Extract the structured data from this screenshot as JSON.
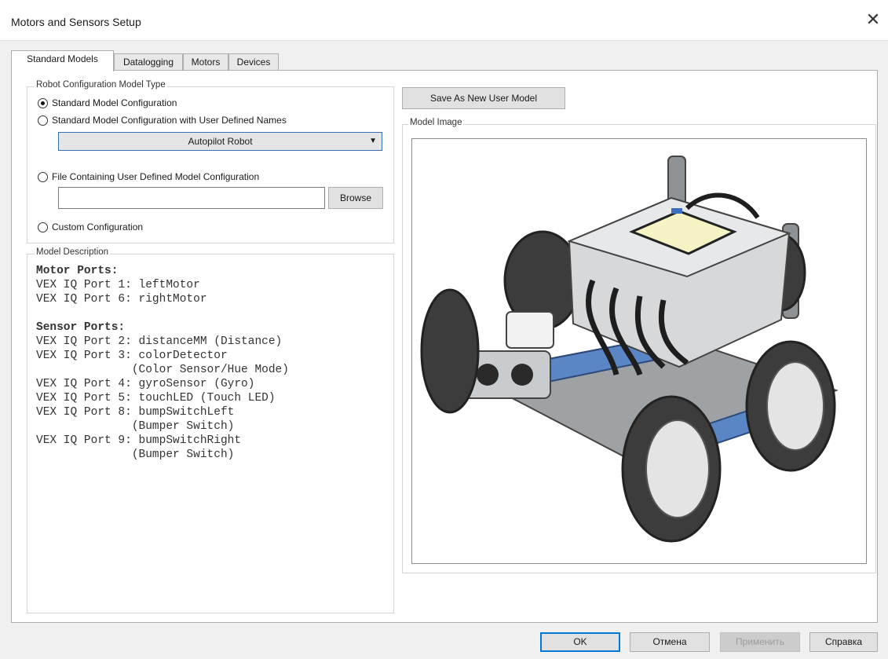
{
  "window": {
    "title": "Motors and Sensors Setup",
    "close_glyph": "✕"
  },
  "tabs": [
    {
      "label": "Standard Models",
      "active": true
    },
    {
      "label": "Datalogging",
      "active": false
    },
    {
      "label": "Motors",
      "active": false
    },
    {
      "label": "Devices",
      "active": false
    }
  ],
  "config_group": {
    "legend": "Robot Configuration Model Type",
    "options": [
      {
        "label": "Standard Model Configuration",
        "selected": true
      },
      {
        "label": "Standard Model Configuration with User Defined Names",
        "selected": false
      },
      {
        "label": "File Containing User Defined Model Configuration",
        "selected": false
      },
      {
        "label": "Custom Configuration",
        "selected": false
      }
    ],
    "model_select": {
      "value": "Autopilot Robot"
    },
    "file_input": {
      "value": ""
    },
    "browse_label": "Browse"
  },
  "description_group": {
    "legend": "Model Description",
    "lines": [
      {
        "text": "Motor Ports:",
        "bold": true
      },
      {
        "text": "VEX IQ Port 1: leftMotor",
        "bold": false
      },
      {
        "text": "VEX IQ Port 6: rightMotor",
        "bold": false
      },
      {
        "text": "",
        "bold": false
      },
      {
        "text": "Sensor Ports:",
        "bold": true
      },
      {
        "text": "VEX IQ Port 2: distanceMM (Distance)",
        "bold": false
      },
      {
        "text": "VEX IQ Port 3: colorDetector",
        "bold": false
      },
      {
        "text": "              (Color Sensor/Hue Mode)",
        "bold": false
      },
      {
        "text": "VEX IQ Port 4: gyroSensor (Gyro)",
        "bold": false
      },
      {
        "text": "VEX IQ Port 5: touchLED (Touch LED)",
        "bold": false
      },
      {
        "text": "VEX IQ Port 8: bumpSwitchLeft",
        "bold": false
      },
      {
        "text": "              (Bumper Switch)",
        "bold": false
      },
      {
        "text": "VEX IQ Port 9: bumpSwitchRight",
        "bold": false
      },
      {
        "text": "              (Bumper Switch)",
        "bold": false
      }
    ]
  },
  "save_model_label": "Save As New User Model",
  "model_image": {
    "legend": "Model Image"
  },
  "footer": {
    "ok_label": "OK",
    "cancel_label": "Отмена",
    "apply_label": "Применить",
    "help_label": "Справка"
  },
  "colors": {
    "accent": "#0078d7",
    "panel": "#ffffff",
    "chrome": "#f0f0f0"
  }
}
